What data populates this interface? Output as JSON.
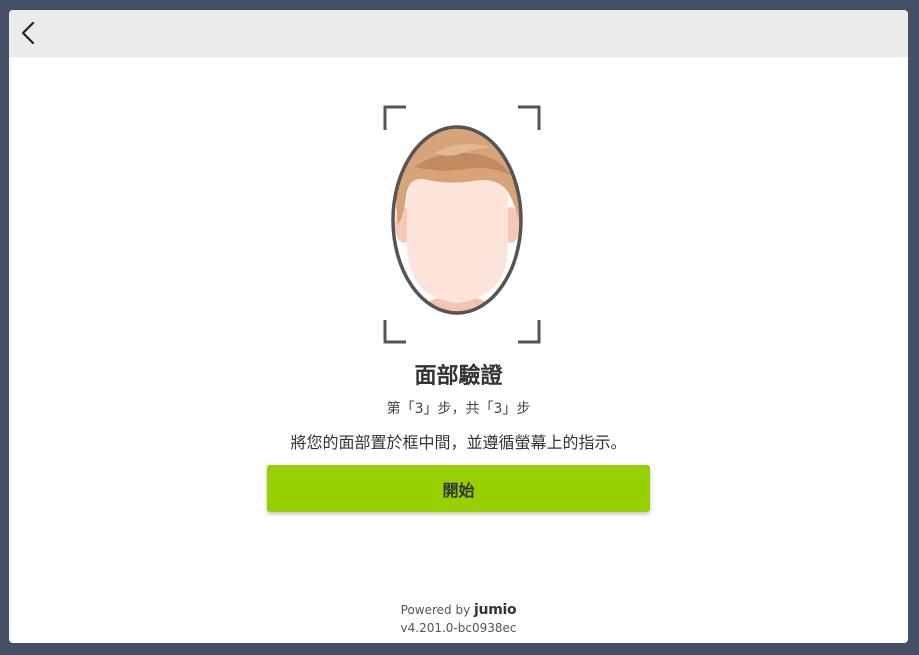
{
  "header": {
    "back_icon": "chevron-left-icon"
  },
  "illustration": {
    "icon": "face-oval-frame-icon"
  },
  "main": {
    "title": "面部驗證",
    "step_text": "第「3」步，共「3」步",
    "instruction": "將您的面部置於框中間，並遵循螢幕上的指示。",
    "start_button_label": "開始"
  },
  "footer": {
    "powered_by_label": "Powered by",
    "brand": "jumio",
    "version": "v4.201.0-bc0938ec"
  },
  "colors": {
    "backdrop": "#454f66",
    "header_bar": "#ebebeb",
    "primary_button": "#97cf00",
    "text": "#333333"
  }
}
